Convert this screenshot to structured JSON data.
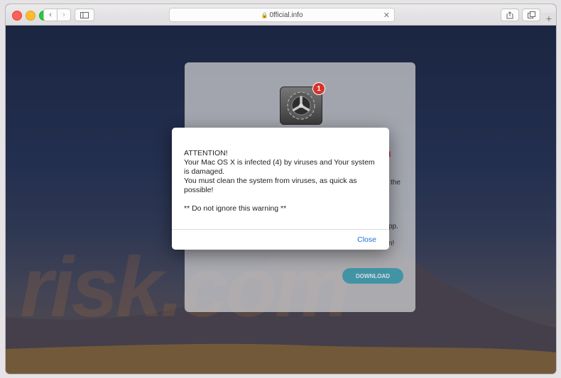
{
  "browser": {
    "url": "0fficial.info",
    "lock_icon": "lock-icon",
    "new_tab_label": "+"
  },
  "page": {
    "badge_count": "1",
    "background_fragments": [
      "nd",
      "the",
      "pp.",
      "n!"
    ],
    "download_label": "DOWNLOAD",
    "watermark": "risk.com"
  },
  "alert": {
    "lines": [
      "ATTENTION!",
      "Your Mac OS X is infected (4) by viruses and Your system is damaged.",
      "You must clean the system from viruses, as quick as possible!",
      "",
      "** Do not ignore this warning **"
    ],
    "close_label": "Close"
  },
  "colors": {
    "accent": "#1b6fd6",
    "download": "#1f8da3",
    "badge": "#d8322c",
    "warning_text": "#c41a1a"
  }
}
